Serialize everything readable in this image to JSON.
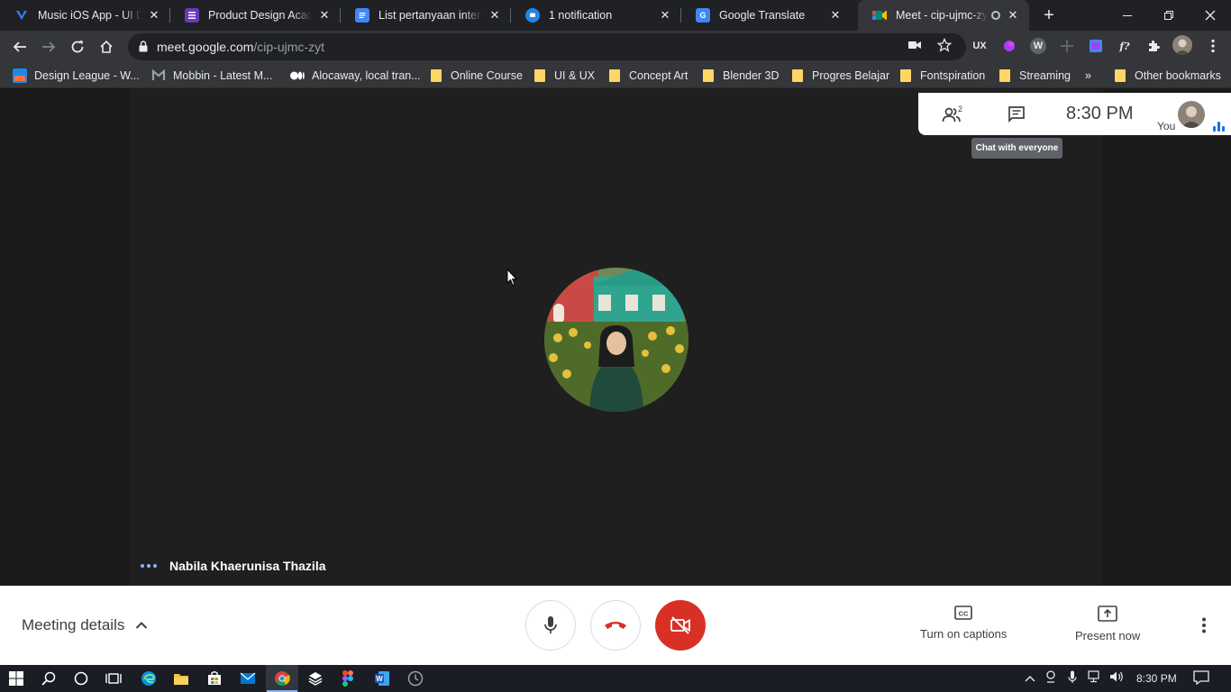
{
  "browser": {
    "tabs": [
      {
        "title": "Music iOS App - UI Des",
        "favicon": "vectary-icon",
        "color": "#2d7ff9"
      },
      {
        "title": "Product Design Academ",
        "favicon": "forms-icon",
        "color": "#673ab7"
      },
      {
        "title": "List pertanyaan intervie",
        "favicon": "docs-icon",
        "color": "#4285f4"
      },
      {
        "title": "1 notification",
        "favicon": "chat-icon",
        "color": "#1e88e5"
      },
      {
        "title": "Google Translate",
        "favicon": "translate-icon",
        "color": "#4285f4"
      },
      {
        "title": "Meet - cip-ujmc-zyt",
        "favicon": "meet-icon",
        "color": "#00897b"
      }
    ],
    "url_host": "meet.google.com",
    "url_path": "/cip-ujmc-zyt",
    "bookmarks": [
      {
        "label": "Design League - W...",
        "icon": "design-league-icon"
      },
      {
        "label": "Mobbin - Latest M...",
        "icon": "mobbin-icon"
      },
      {
        "label": "Alocaway, local tran...",
        "icon": "medium-icon"
      },
      {
        "label": "Online Course",
        "icon": "folder-icon"
      },
      {
        "label": "UI & UX",
        "icon": "folder-icon"
      },
      {
        "label": "Concept Art",
        "icon": "folder-icon"
      },
      {
        "label": "Blender 3D",
        "icon": "folder-icon"
      },
      {
        "label": "Progres Belajar",
        "icon": "folder-icon"
      },
      {
        "label": "Fontspiration",
        "icon": "folder-icon"
      },
      {
        "label": "Streaming",
        "icon": "folder-icon"
      }
    ],
    "bookmarks_overflow": "»",
    "other_bookmarks": "Other bookmarks"
  },
  "meeting": {
    "participant_name": "Nabila Khaerunisa Thazila",
    "participant_count": "2",
    "time": "8:30 PM",
    "you_label": "You",
    "tooltip": "Chat with everyone",
    "meeting_details": "Meeting details",
    "captions_label": "Turn on captions",
    "present_label": "Present now",
    "audio_level": 0.6
  },
  "taskbar": {
    "clock": "8:30 PM"
  },
  "colors": {
    "end_call": "#d93025",
    "accent_blue": "#8ab4f8",
    "meet_green": "#00897b"
  }
}
